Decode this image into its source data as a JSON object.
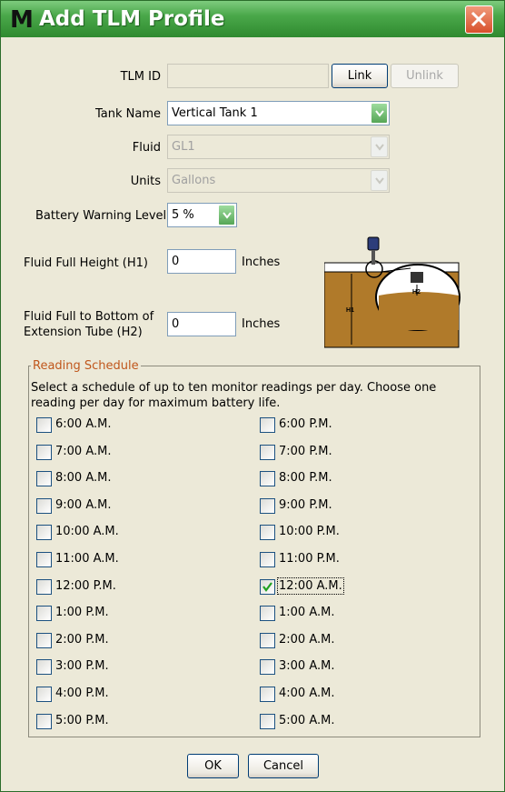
{
  "window": {
    "app_logo": "M",
    "title": "Add TLM Profile"
  },
  "form": {
    "tlm_id": {
      "label": "TLM ID",
      "value": ""
    },
    "link_label": "Link",
    "unlink_label": "Unlink",
    "tank_name": {
      "label": "Tank Name",
      "value": "Vertical Tank 1"
    },
    "fluid": {
      "label": "Fluid",
      "value": "GL1"
    },
    "units": {
      "label": "Units",
      "value": "Gallons"
    },
    "battery": {
      "label": "Battery Warning Level",
      "value": "5 %"
    },
    "h1": {
      "label": "Fluid Full Height (H1)",
      "value": "0",
      "unit": "Inches"
    },
    "h2": {
      "label_line1": "Fluid Full to Bottom of",
      "label_line2": "Extension Tube (H2)",
      "value": "0",
      "unit": "Inches"
    }
  },
  "diagram": {
    "h1_label": "H1",
    "h2_label": "H2"
  },
  "schedule": {
    "legend": "Reading Schedule",
    "description": "Select a schedule of up to ten monitor readings per day. Choose one reading per day for maximum battery life.",
    "left": [
      {
        "label": "6:00 A.M.",
        "checked": false
      },
      {
        "label": "7:00 A.M.",
        "checked": false
      },
      {
        "label": "8:00 A.M.",
        "checked": false
      },
      {
        "label": "9:00 A.M.",
        "checked": false
      },
      {
        "label": "10:00 A.M.",
        "checked": false
      },
      {
        "label": "11:00 A.M.",
        "checked": false
      },
      {
        "label": "12:00 P.M.",
        "checked": false
      },
      {
        "label": "1:00 P.M.",
        "checked": false
      },
      {
        "label": "2:00 P.M.",
        "checked": false
      },
      {
        "label": "3:00 P.M.",
        "checked": false
      },
      {
        "label": "4:00 P.M.",
        "checked": false
      },
      {
        "label": "5:00 P.M.",
        "checked": false
      }
    ],
    "right": [
      {
        "label": "6:00 P.M.",
        "checked": false
      },
      {
        "label": "7:00 P.M.",
        "checked": false
      },
      {
        "label": "8:00 P.M.",
        "checked": false
      },
      {
        "label": "9:00 P.M.",
        "checked": false
      },
      {
        "label": "10:00 P.M.",
        "checked": false
      },
      {
        "label": "11:00 P.M.",
        "checked": false
      },
      {
        "label": "12:00 A.M.",
        "checked": true
      },
      {
        "label": "1:00 A.M.",
        "checked": false
      },
      {
        "label": "2:00 A.M.",
        "checked": false
      },
      {
        "label": "3:00 A.M.",
        "checked": false
      },
      {
        "label": "4:00 A.M.",
        "checked": false
      },
      {
        "label": "5:00 A.M.",
        "checked": false
      }
    ]
  },
  "footer": {
    "ok_label": "OK",
    "cancel_label": "Cancel"
  },
  "colors": {
    "title_green": "#4aa84a",
    "legend_orange": "#c0571c",
    "fluid_brown": "#b07a2a"
  }
}
